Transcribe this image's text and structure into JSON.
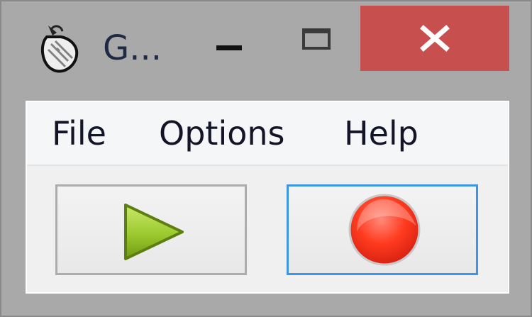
{
  "window": {
    "title": "G...",
    "icon": "mouse-pointer-icon",
    "controls": {
      "minimize_icon": "minimize-icon",
      "maximize_icon": "maximize-icon",
      "close_icon": "close-icon",
      "close_color": "#c7504f"
    }
  },
  "menubar": {
    "items": [
      {
        "label": "File"
      },
      {
        "label": "Options"
      },
      {
        "label": "Help"
      }
    ]
  },
  "toolbar": {
    "play_button": {
      "icon": "play-icon",
      "color": "#9acd32"
    },
    "record_button": {
      "icon": "record-icon",
      "color": "#ff3b1f",
      "focused": true
    }
  }
}
